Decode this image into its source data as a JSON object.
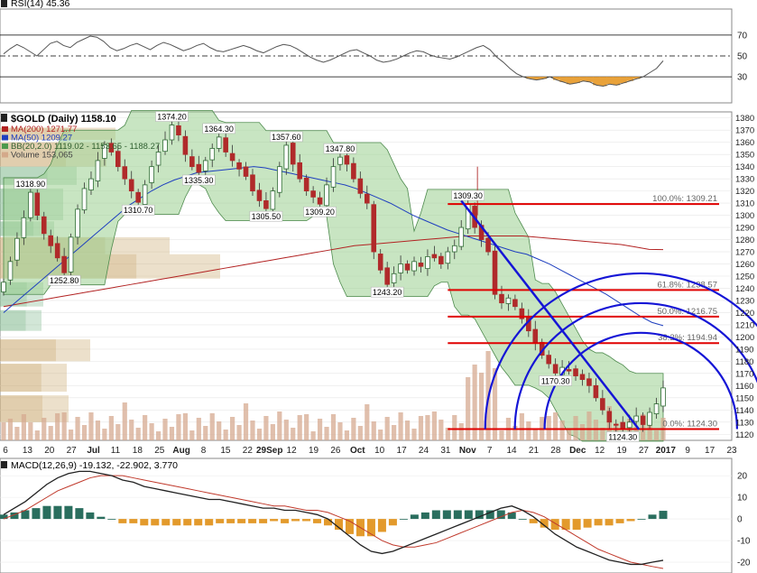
{
  "chart_data": [
    {
      "type": "line",
      "panel": "rsi",
      "title": "RSI(14) 45.36",
      "levels": [
        70,
        50,
        30
      ],
      "yticks": [
        70,
        50,
        30
      ],
      "ylim": [
        5,
        95
      ],
      "series": [
        {
          "name": "RSI(14)",
          "values": [
            52,
            57,
            61,
            58,
            54,
            50,
            56,
            62,
            64,
            60,
            58,
            63,
            66,
            69,
            68,
            64,
            58,
            55,
            57,
            60,
            62,
            59,
            56,
            60,
            63,
            61,
            58,
            55,
            57,
            60,
            62,
            58,
            55,
            54,
            56,
            58,
            60,
            58,
            55,
            53,
            56,
            59,
            61,
            60,
            57,
            53,
            49,
            46,
            44,
            46,
            49,
            52,
            55,
            56,
            53,
            50,
            46,
            44,
            45,
            47,
            50,
            53,
            55,
            54,
            51,
            49,
            48,
            47,
            49,
            52,
            55,
            58,
            60,
            56,
            49,
            44,
            38,
            33,
            30,
            28,
            27,
            28,
            30,
            27,
            25,
            23,
            24,
            26,
            25,
            22,
            21,
            23,
            22,
            24,
            26,
            28,
            30,
            34,
            38,
            45.36
          ]
        }
      ]
    },
    {
      "type": "line",
      "panel": "price",
      "title": "$GOLD (Daily) 1158.10",
      "legend": [
        {
          "label": "MA(200) 1271.77",
          "color": "#b22222"
        },
        {
          "label": "MA(50) 1209.27",
          "color": "#1f3fbf"
        },
        {
          "label": "BB(20,2.0) 1119.02 - 1153.65 - 1188.27",
          "color": "#4d9a4d"
        },
        {
          "label": "Volume 153,065",
          "color": "#d4a98a"
        }
      ],
      "ylim": [
        1115,
        1385
      ],
      "yticks": [
        1380,
        1370,
        1360,
        1350,
        1340,
        1330,
        1320,
        1310,
        1300,
        1290,
        1280,
        1270,
        1260,
        1250,
        1240,
        1230,
        1220,
        1210,
        1200,
        1190,
        1180,
        1170,
        1160,
        1150,
        1140,
        1130,
        1120
      ],
      "xticks": [
        "6",
        "13",
        "20",
        "27",
        "Jul",
        "11",
        "18",
        "25",
        "Aug",
        "8",
        "15",
        "22",
        "29Sep",
        "12",
        "19",
        "26",
        "Oct",
        "10",
        "17",
        "24",
        "31",
        "Nov",
        "7",
        "14",
        "21",
        "28",
        "Dec",
        "12",
        "19",
        "27",
        "2017",
        "9",
        "17",
        "23"
      ],
      "close": [
        1245,
        1262,
        1281,
        1298,
        1318.9,
        1300,
        1285,
        1275,
        1265,
        1252.8,
        1282,
        1305,
        1322,
        1330,
        1345,
        1358,
        1352,
        1340,
        1330,
        1320,
        1310.7,
        1325,
        1340,
        1352,
        1362,
        1374.2,
        1366,
        1350,
        1340,
        1335.3,
        1345,
        1355,
        1364.3,
        1352,
        1345,
        1338,
        1332,
        1320,
        1312,
        1305.5,
        1320,
        1340,
        1357.6,
        1342,
        1330,
        1320,
        1315,
        1309.2,
        1325,
        1340,
        1347.8,
        1342,
        1330,
        1318,
        1310,
        1270,
        1255,
        1243.2,
        1252,
        1260,
        1255,
        1262,
        1258,
        1266,
        1265,
        1260,
        1270,
        1275,
        1290,
        1309.3,
        1290,
        1280,
        1270,
        1235,
        1228,
        1232,
        1225,
        1215,
        1205,
        1195,
        1185,
        1178,
        1170.3,
        1175,
        1172,
        1168,
        1165,
        1160,
        1150,
        1140,
        1130,
        1128,
        1124.3,
        1130,
        1135,
        1128,
        1138,
        1145,
        1158.1
      ],
      "series": [
        {
          "name": "MA(200)",
          "values": [
            1225,
            1227,
            1229,
            1231,
            1233,
            1235,
            1237,
            1239,
            1241,
            1243,
            1245,
            1247,
            1249,
            1251,
            1253,
            1255,
            1257,
            1259,
            1261,
            1263,
            1265,
            1267,
            1269,
            1271,
            1273,
            1275,
            1276,
            1277,
            1278,
            1279,
            1280,
            1281,
            1282,
            1283,
            1283,
            1283,
            1283,
            1283,
            1282,
            1281,
            1280,
            1279,
            1278,
            1277,
            1276,
            1274,
            1272,
            1271.77
          ]
        },
        {
          "name": "MA(50)",
          "values": [
            1220,
            1228,
            1236,
            1244,
            1252,
            1260,
            1268,
            1276,
            1284,
            1292,
            1300,
            1308,
            1314,
            1320,
            1325,
            1329,
            1332,
            1335,
            1336,
            1337,
            1338,
            1339,
            1340,
            1339,
            1337,
            1335,
            1333,
            1331,
            1329,
            1327,
            1325,
            1322,
            1318,
            1314,
            1310,
            1305,
            1300,
            1296,
            1292,
            1288,
            1285,
            1282,
            1279,
            1276,
            1273,
            1270,
            1268,
            1264,
            1260,
            1255,
            1250,
            1245,
            1240,
            1235,
            1229,
            1223,
            1217,
            1212,
            1209.27
          ]
        }
      ],
      "price_labels": [
        {
          "text": "1318.90",
          "x": 4,
          "y": 1318.9
        },
        {
          "text": "1252.80",
          "x": 9,
          "y": 1252.8
        },
        {
          "text": "1310.70",
          "x": 20,
          "y": 1310.7
        },
        {
          "text": "1374.20",
          "x": 25,
          "y": 1374.2
        },
        {
          "text": "1335.30",
          "x": 29,
          "y": 1335.3
        },
        {
          "text": "1364.30",
          "x": 32,
          "y": 1364.3
        },
        {
          "text": "1305.50",
          "x": 39,
          "y": 1305.5
        },
        {
          "text": "1357.60",
          "x": 42,
          "y": 1357.6
        },
        {
          "text": "1309.20",
          "x": 47,
          "y": 1309.2
        },
        {
          "text": "1347.80",
          "x": 50,
          "y": 1347.8
        },
        {
          "text": "1243.20",
          "x": 57,
          "y": 1243.2
        },
        {
          "text": "1309.30",
          "x": 69,
          "y": 1309.3
        },
        {
          "text": "1170.30",
          "x": 82,
          "y": 1170.3
        },
        {
          "text": "1124.30",
          "x": 92,
          "y": 1124.3
        }
      ],
      "fibonacci": [
        {
          "label": "100.0%: 1309.21",
          "value": 1309.21
        },
        {
          "label": "61.8%: 1238.57",
          "value": 1238.57
        },
        {
          "label": "50.0%: 1216.75",
          "value": 1216.75
        },
        {
          "label": "38.2%: 1194.94",
          "value": 1194.94
        },
        {
          "label": "0.0%: 1124.30",
          "value": 1124.3
        }
      ]
    },
    {
      "type": "line",
      "panel": "macd",
      "title": "MACD(12,26,9) -19.132, -22.902, 3.770",
      "ylim": [
        -25,
        28
      ],
      "yticks": [
        20,
        10,
        0,
        -10,
        -20
      ],
      "series": [
        {
          "name": "MACD",
          "values": [
            2,
            5,
            8,
            12,
            16,
            19,
            21,
            22,
            22,
            21,
            20,
            18,
            17,
            15,
            14,
            13,
            12,
            11,
            10,
            9,
            9,
            8,
            7,
            6,
            5,
            5,
            4,
            4,
            3,
            2,
            0,
            -4,
            -8,
            -12,
            -15,
            -16,
            -15,
            -13,
            -11,
            -9,
            -7,
            -5,
            -3,
            -1,
            1,
            3,
            5,
            6,
            4,
            1,
            -3,
            -7,
            -10,
            -13,
            -15,
            -17,
            -19,
            -20,
            -21,
            -21,
            -20,
            -19.132
          ]
        },
        {
          "name": "Signal",
          "values": [
            0,
            2,
            4,
            7,
            10,
            13,
            15,
            17,
            19,
            20,
            20,
            20,
            19,
            18,
            17,
            16,
            15,
            14,
            13,
            12,
            11,
            10,
            9,
            8,
            7,
            6,
            6,
            5,
            4,
            4,
            3,
            1,
            -1,
            -4,
            -7,
            -10,
            -12,
            -13,
            -13,
            -12,
            -11,
            -9,
            -7,
            -5,
            -3,
            -1,
            1,
            3,
            4,
            3,
            1,
            -2,
            -5,
            -8,
            -11,
            -14,
            -16,
            -18,
            -20,
            -21,
            -22,
            -22.902
          ]
        },
        {
          "name": "Histogram",
          "values": [
            2,
            3,
            4,
            5,
            6,
            6,
            6,
            5,
            3,
            1,
            0,
            -2,
            -2,
            -3,
            -3,
            -3,
            -3,
            -3,
            -3,
            -3,
            -2,
            -2,
            -2,
            -2,
            -2,
            -1,
            -2,
            -1,
            -1,
            -2,
            -3,
            -5,
            -7,
            -8,
            -8,
            -6,
            -3,
            0,
            2,
            3,
            4,
            4,
            4,
            4,
            4,
            4,
            4,
            3,
            0,
            -2,
            -4,
            -5,
            -5,
            -5,
            -4,
            -3,
            -3,
            -2,
            -1,
            0,
            2,
            3.77
          ]
        }
      ]
    }
  ],
  "colors": {
    "up": "#2e6b33",
    "down": "#b02a2a",
    "ma200": "#b22222",
    "ma50": "#1f3fbf",
    "bb_fill": "#9bcf8f",
    "fib_line": "#e00000",
    "arc": "#1515d6",
    "volume": "#d6aa90",
    "vap_green": "#7fb88c",
    "vap_tan": "#c9a56b",
    "macd_pos": "#2a6e5e",
    "macd_neg": "#e39a2c"
  }
}
